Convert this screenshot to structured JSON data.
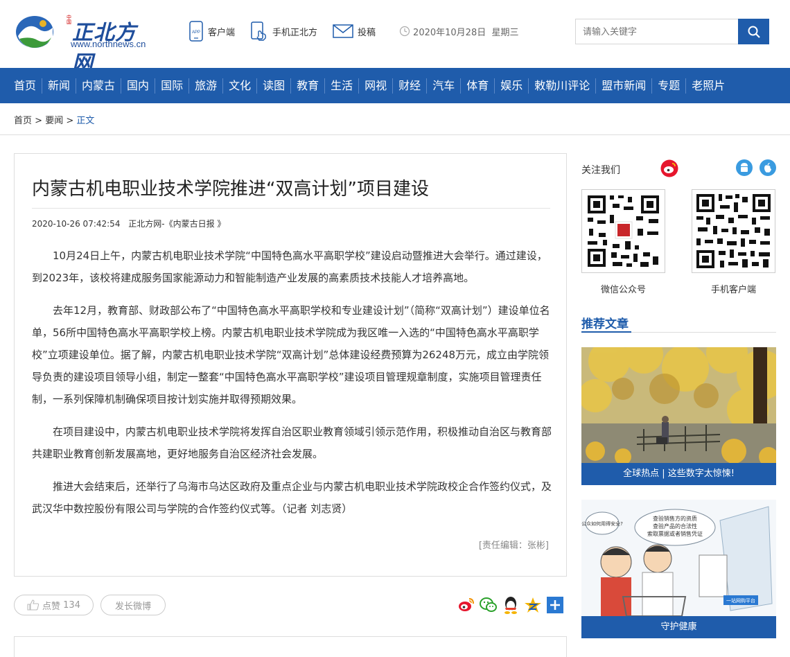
{
  "site": {
    "name_cn": "正北方网",
    "domain": "www.northnews.cn",
    "tag": "中国"
  },
  "header": {
    "links": [
      {
        "label": "客户端",
        "icon": "app-phone-icon"
      },
      {
        "label": "手机正北方",
        "icon": "mobile-touch-icon"
      },
      {
        "label": "投稿",
        "icon": "envelope-icon"
      }
    ],
    "date": "2020年10月28日",
    "weekday": "星期三",
    "search_placeholder": "请输入关键字"
  },
  "nav": [
    "首页",
    "新闻",
    "内蒙古",
    "国内",
    "国际",
    "旅游",
    "文化",
    "读图",
    "教育",
    "生活",
    "网视",
    "财经",
    "汽车",
    "体育",
    "娱乐",
    "敕勒川评论",
    "盟市新闻",
    "专题",
    "老照片"
  ],
  "breadcrumb": {
    "home": "首页",
    "section": "要闻",
    "sep": ">",
    "current": "正文"
  },
  "article": {
    "title": "内蒙古机电职业技术学院推进“双高计划”项目建设",
    "datetime": "2020-10-26 07:42:54",
    "source": "正北方网-《内蒙古日报 》",
    "paragraphs": [
      "10月24日上午，内蒙古机电职业技术学院“中国特色高水平高职学校”建设启动暨推进大会举行。通过建设，到2023年，该校将建成服务国家能源动力和智能制造产业发展的高素质技术技能人才培养高地。",
      "去年12月，教育部、财政部公布了“中国特色高水平高职学校和专业建设计划”（简称“双高计划”）建设单位名单，56所中国特色高水平高职学校上榜。内蒙古机电职业技术学院成为我区唯一入选的“中国特色高水平高职学校”立项建设单位。据了解，内蒙古机电职业技术学院“双高计划”总体建设经费预算为26248万元，成立由学院领导负责的建设项目领导小组，制定一整套“中国特色高水平高职学校”建设项目管理规章制度，实施项目管理责任制，一系列保障机制确保项目按计划实施并取得预期效果。",
      "在项目建设中，内蒙古机电职业技术学院将发挥自治区职业教育领域引领示范作用，积极推动自治区与教育部共建职业教育创新发展高地，更好地服务自治区经济社会发展。",
      "推进大会结束后，还举行了乌海市乌达区政府及重点企业与内蒙古机电职业技术学院政校企合作签约仪式，及武汉华中数控股份有限公司与学院的合作签约仪式等。（记者  刘志贤）"
    ],
    "editor": "[责任编辑：张彬]"
  },
  "actions": {
    "like_label": "点赞",
    "like_count": "134",
    "weibo_post_label": "发长微博",
    "share_icons": [
      "weibo-share-icon",
      "wechat-share-icon",
      "qq-share-icon",
      "qzone-share-icon",
      "more-share-icon"
    ]
  },
  "sidebar": {
    "follow_label": "关注我们",
    "qr_codes": [
      {
        "label": "微信公众号"
      },
      {
        "label": "手机客户端"
      }
    ],
    "recommend_title": "推荐文章",
    "recommend_cards": [
      {
        "caption": "全球热点 | 这些数字太惊悚!"
      },
      {
        "caption": "守护健康"
      }
    ],
    "cartoon_bubbles": [
      "公众如何用得安全?",
      "查验销售方的资质",
      "查验产品的合法性",
      "索取票据或者销售凭证",
      "一站网购平台"
    ]
  },
  "colors": {
    "brand_blue": "#1f5cab",
    "nav_sep": "#5b88c7"
  }
}
